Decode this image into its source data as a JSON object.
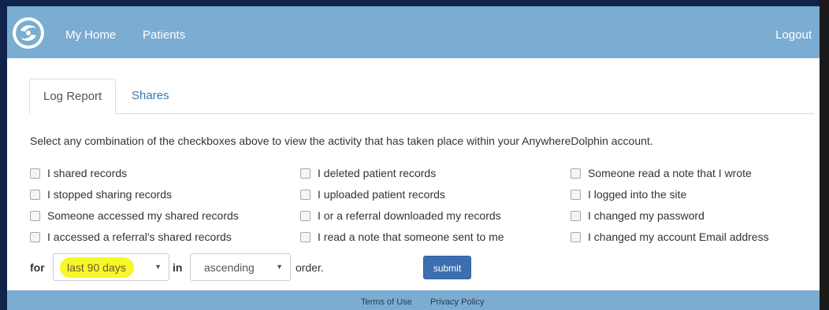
{
  "nav": {
    "logo_icon": "dolphin-logo-icon",
    "home": "My Home",
    "patients": "Patients",
    "logout": "Logout",
    "bar_color": "#7bacd1"
  },
  "tabs": [
    {
      "label": "Log Report",
      "active": true
    },
    {
      "label": "Shares",
      "active": false
    }
  ],
  "description": "Select any combination of the checkboxes above to view the activity that has taken place within your AnywhereDolphin account.",
  "checkboxes": [
    {
      "label": "I shared records",
      "checked": false
    },
    {
      "label": "I stopped sharing records",
      "checked": false
    },
    {
      "label": "Someone accessed my shared records",
      "checked": false
    },
    {
      "label": "I accessed a referral's shared records",
      "checked": false
    },
    {
      "label": "I deleted patient records",
      "checked": false
    },
    {
      "label": "I uploaded patient records",
      "checked": false
    },
    {
      "label": "I or a referral downloaded my records",
      "checked": false
    },
    {
      "label": "I read a note that someone sent to me",
      "checked": false
    },
    {
      "label": "Someone read a note that I wrote",
      "checked": false
    },
    {
      "label": "I logged into the site",
      "checked": false
    },
    {
      "label": "I changed my password",
      "checked": false
    },
    {
      "label": "I changed my account Email address",
      "checked": false
    }
  ],
  "filter": {
    "for_label": "for",
    "range_value": "last 90 days",
    "in_label": "in",
    "order_value": "ascending",
    "order_label": "order.",
    "submit_label": "submit",
    "highlight_color": "#f7f72a"
  },
  "footer": {
    "terms": "Terms of Use",
    "privacy": "Privacy Policy"
  }
}
